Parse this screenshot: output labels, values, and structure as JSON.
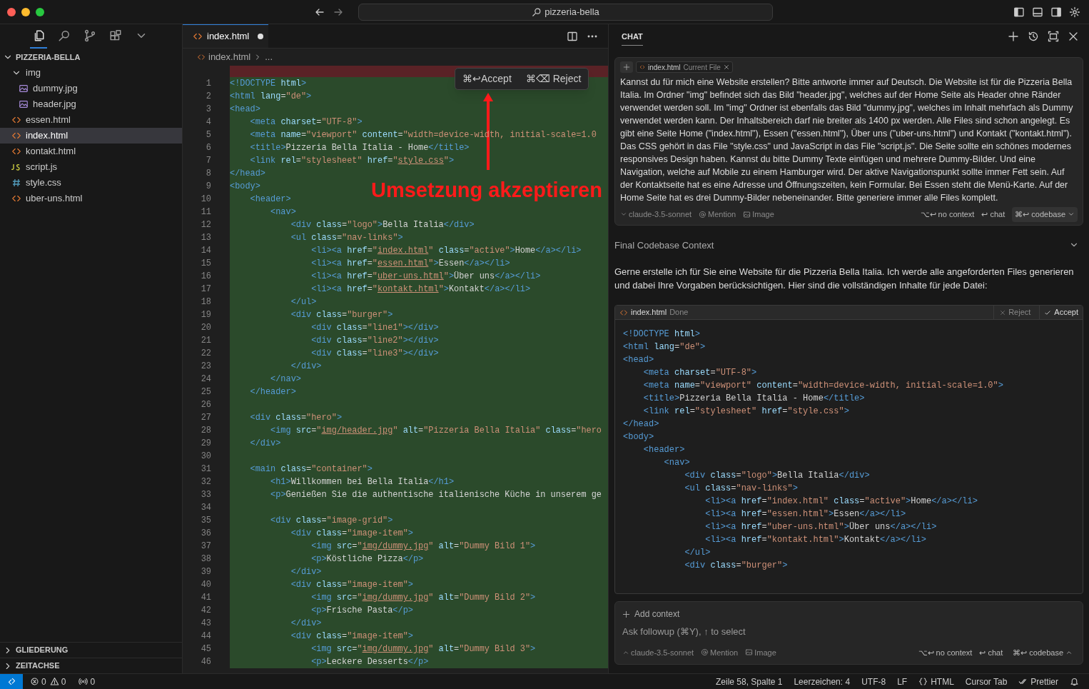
{
  "titlebar": {
    "search": "pizzeria-bella"
  },
  "activity_icons": [
    {
      "kind": "files",
      "selected": true
    },
    {
      "kind": "search",
      "selected": false
    },
    {
      "kind": "source-control",
      "selected": false
    },
    {
      "kind": "extensions",
      "selected": false
    },
    {
      "kind": "more",
      "selected": false
    }
  ],
  "explorer": {
    "label": "PIZZERIA-BELLA",
    "expanded": true,
    "children": [
      {
        "label": "img",
        "kind": "folder",
        "expanded": true,
        "selected": false,
        "children": [
          {
            "label": "dummy.jpg",
            "kind": "image",
            "selected": false
          },
          {
            "label": "header.jpg",
            "kind": "image",
            "selected": false
          }
        ]
      },
      {
        "label": "essen.html",
        "kind": "html",
        "selected": false
      },
      {
        "label": "index.html",
        "kind": "html",
        "selected": true
      },
      {
        "label": "kontakt.html",
        "kind": "html",
        "selected": false
      },
      {
        "label": "script.js",
        "kind": "js",
        "selected": false
      },
      {
        "label": "style.css",
        "kind": "css",
        "selected": false
      },
      {
        "label": "uber-uns.html",
        "kind": "html",
        "selected": false
      }
    ]
  },
  "sidebar_sections": [
    {
      "label": "GLIEDERUNG",
      "expanded": false
    },
    {
      "label": "ZEITACHSE",
      "expanded": false
    }
  ],
  "editor": {
    "tabs": [
      {
        "label": "index.html",
        "modified": true,
        "selected": true
      }
    ],
    "breadcrumb": [
      "index.html",
      "..."
    ],
    "removed_band": true,
    "lines_added": true,
    "link_underline": true,
    "popup": {
      "accept": "⌘↩Accept",
      "reject": "⌘⌫ Reject"
    },
    "annotation": "Umsetzung akzeptieren",
    "lines": [
      {
        "n": "1",
        "code": "<!DOCTYPE html>"
      },
      {
        "n": "2",
        "code": "<html lang=\"de\">"
      },
      {
        "n": "3",
        "code": "<head>"
      },
      {
        "n": "4",
        "code": "    <meta charset=\"UTF-8\">"
      },
      {
        "n": "5",
        "code": "    <meta name=\"viewport\" content=\"width=device-width, initial-scale=1.0"
      },
      {
        "n": "6",
        "code": "    <title>Pizzeria Bella Italia - Home</title>"
      },
      {
        "n": "7",
        "code": "    <link rel=\"stylesheet\" href=\"style.css\">"
      },
      {
        "n": "8",
        "code": "</head>"
      },
      {
        "n": "9",
        "code": "<body>"
      },
      {
        "n": "10",
        "code": "    <header>"
      },
      {
        "n": "11",
        "code": "        <nav>"
      },
      {
        "n": "12",
        "code": "            <div class=\"logo\">Bella Italia</div>"
      },
      {
        "n": "13",
        "code": "            <ul class=\"nav-links\">"
      },
      {
        "n": "14",
        "code": "                <li><a href=\"index.html\" class=\"active\">Home</a></li>"
      },
      {
        "n": "15",
        "code": "                <li><a href=\"essen.html\">Essen</a></li>"
      },
      {
        "n": "16",
        "code": "                <li><a href=\"uber-uns.html\">Über uns</a></li>"
      },
      {
        "n": "17",
        "code": "                <li><a href=\"kontakt.html\">Kontakt</a></li>"
      },
      {
        "n": "18",
        "code": "            </ul>"
      },
      {
        "n": "19",
        "code": "            <div class=\"burger\">"
      },
      {
        "n": "20",
        "code": "                <div class=\"line1\"></div>"
      },
      {
        "n": "21",
        "code": "                <div class=\"line2\"></div>"
      },
      {
        "n": "22",
        "code": "                <div class=\"line3\"></div>"
      },
      {
        "n": "23",
        "code": "            </div>"
      },
      {
        "n": "24",
        "code": "        </nav>"
      },
      {
        "n": "25",
        "code": "    </header>"
      },
      {
        "n": "26"
      },
      {
        "n": "27",
        "code": "    <div class=\"hero\">"
      },
      {
        "n": "28",
        "code": "        <img src=\"img/header.jpg\" alt=\"Pizzeria Bella Italia\" class=\"hero"
      },
      {
        "n": "29",
        "code": "    </div>"
      },
      {
        "n": "30"
      },
      {
        "n": "31",
        "code": "    <main class=\"container\">"
      },
      {
        "n": "32",
        "code": "        <h1>Willkommen bei Bella Italia</h1>"
      },
      {
        "n": "33",
        "code": "        <p>Genießen Sie die authentische italienische Küche in unserem ge"
      },
      {
        "n": "34"
      },
      {
        "n": "35",
        "code": "        <div class=\"image-grid\">"
      },
      {
        "n": "36",
        "code": "            <div class=\"image-item\">"
      },
      {
        "n": "37",
        "code": "                <img src=\"img/dummy.jpg\" alt=\"Dummy Bild 1\">"
      },
      {
        "n": "38",
        "code": "                <p>Köstliche Pizza</p>"
      },
      {
        "n": "39",
        "code": "            </div>"
      },
      {
        "n": "40",
        "code": "            <div class=\"image-item\">"
      },
      {
        "n": "41",
        "code": "                <img src=\"img/dummy.jpg\" alt=\"Dummy Bild 2\">"
      },
      {
        "n": "42",
        "code": "                <p>Frische Pasta</p>"
      },
      {
        "n": "43",
        "code": "            </div>"
      },
      {
        "n": "44",
        "code": "            <div class=\"image-item\">"
      },
      {
        "n": "45",
        "code": "                <img src=\"img/dummy.jpg\" alt=\"Dummy Bild 3\">"
      },
      {
        "n": "46",
        "code": "                <p>Leckere Desserts</p>"
      }
    ]
  },
  "chat": {
    "title": "CHAT",
    "prompt": {
      "chip_file": "index.html",
      "chip_note": "Current File",
      "message": "Kannst du für mich eine Website erstellen? Bitte antworte immer auf Deutsch. Die Website ist für die Pizzeria Bella Italia. Im Ordner \"img\" befindet sich das Bild \"header.jpg\", welches auf der Home Seite als Header ohne Ränder verwendet werden soll. Im \"img\" Ordner ist ebenfalls das Bild \"dummy.jpg\", welches im Inhalt mehrfach als Dummy verwendet werden kann. Der Inhaltsbereich darf nie breiter als 1400 px werden. Alle Files sind schon angelegt. Es gibt eine Seite Home (\"index.html\"), Essen (\"essen.html\"), Über uns (\"uber-uns.html\") und Kontakt (\"kontakt.html\"). Das CSS gehört in das File \"style.css\" und JavaScript in das File \"script.js\". Die Seite sollte ein schönes modernes responsives Design haben. Kannst du bitte Dummy Texte einfügen und mehrere Dummy-Bilder. Und eine Navigation, welche auf Mobile zu einem Hamburger wird. Der aktive Navigationspunkt sollte immer Fett sein. Auf der Kontaktseite hat es eine Adresse und Öffnungszeiten, kein Formular. Bei Essen steht die Menü-Karte. Auf der Home Seite hat es drei Dummy-Bilder nebeneinander. Bitte generiere immer alle Files komplett.",
      "model": "claude-3.5-sonnet",
      "mention": "Mention",
      "image": "Image",
      "no_context": "⌥↩ no context",
      "chat": "↩ chat",
      "codebase": "⌘↩ codebase"
    },
    "context_heading": "Final Codebase Context",
    "context_expanded": false,
    "response": "Gerne erstelle ich für Sie eine Website für die Pizzeria Bella Italia. Ich werde alle angeforderten Files generieren und dabei Ihre Vorgaben berücksichtigen. Hier sind die vollständigen Inhalte für jede Datei:",
    "code_block": {
      "file": "index.html",
      "status": "Done",
      "reject": "Reject",
      "accept": "Accept",
      "link_underline": false,
      "lines": [
        "<!DOCTYPE html>",
        "<html lang=\"de\">",
        "<head>",
        "    <meta charset=\"UTF-8\">",
        "    <meta name=\"viewport\" content=\"width=device-width, initial-scale=1.0\">",
        "    <title>Pizzeria Bella Italia - Home</title>",
        "    <link rel=\"stylesheet\" href=\"style.css\">",
        "</head>",
        "<body>",
        "    <header>",
        "        <nav>",
        "            <div class=\"logo\">Bella Italia</div>",
        "            <ul class=\"nav-links\">",
        "                <li><a href=\"index.html\" class=\"active\">Home</a></li>",
        "                <li><a href=\"essen.html\">Essen</a></li>",
        "                <li><a href=\"uber-uns.html\">Über uns</a></li>",
        "                <li><a href=\"kontakt.html\">Kontakt</a></li>",
        "            </ul>",
        "            <div class=\"burger\">"
      ]
    },
    "followup": {
      "add_context": "Add context",
      "placeholder": "Ask followup (⌘Y), ↑ to select",
      "model": "claude-3.5-sonnet",
      "mention": "Mention",
      "image": "Image",
      "no_context": "⌥↩ no context",
      "chat": "↩ chat",
      "codebase": "⌘↩ codebase"
    }
  },
  "status_bar": {
    "errors": "0",
    "warnings": "0",
    "ports": "0",
    "right": [
      {
        "text": "Zeile 58, Spalte 1"
      },
      {
        "text": "Leerzeichen: 4"
      },
      {
        "text": "UTF-8"
      },
      {
        "text": "LF"
      },
      {
        "text": "HTML",
        "kind": "braces"
      },
      {
        "text": "Cursor Tab"
      },
      {
        "text": "Prettier",
        "kind": "checks"
      }
    ]
  }
}
